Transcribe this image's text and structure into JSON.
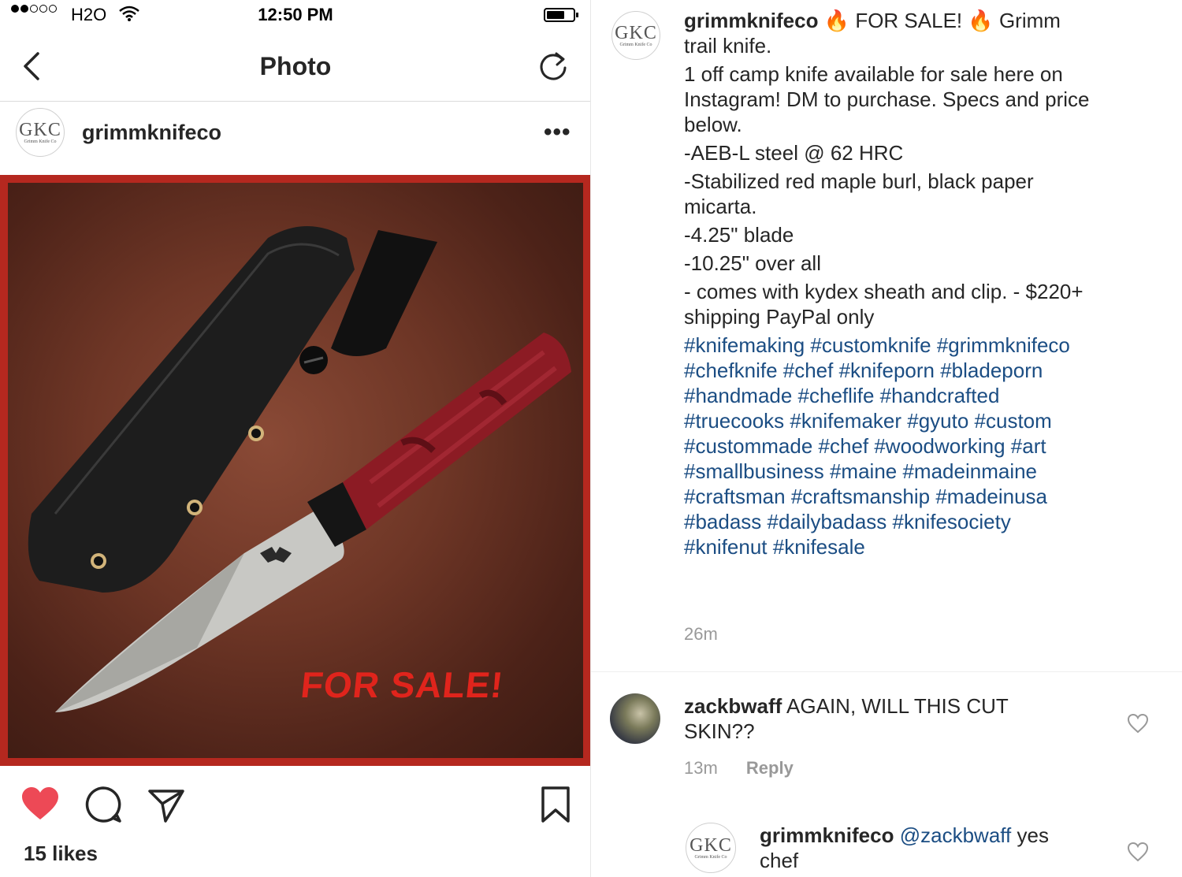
{
  "status_bar": {
    "carrier": "H2O",
    "time": "12:50 PM"
  },
  "nav": {
    "title": "Photo",
    "back_icon": "chevron-left-icon",
    "refresh_icon": "refresh-icon"
  },
  "post": {
    "username": "grimmknifeco",
    "avatar_monogram": "GKC",
    "avatar_subtext": "Grimm Knife Co",
    "more_label": "•••",
    "overlay_text": "FOR SALE!",
    "likes": "15 likes",
    "liked": true,
    "colors": {
      "like": "#ed4956",
      "photo_border": "#e3251b",
      "hashtag": "#1b4d83"
    }
  },
  "caption": {
    "username": "grimmknifeco",
    "first_line": " 🔥 FOR SALE! 🔥 Grimm trail knife.",
    "lines": [
      "1 off camp knife available for sale here on Instagram! DM to purchase. Specs and price below.",
      "-AEB-L steel @ 62 HRC",
      "-Stabilized red maple burl, black paper micarta.",
      "-4.25\" blade",
      "-10.25\" over all",
      "- comes with kydex sheath and clip. - $220+ shipping PayPal only"
    ],
    "hashtags": "#knifemaking #customknife #grimmknifeco #chefknife #chef #knifeporn #bladeporn #handmade #cheflife #handcrafted #truecooks #knifemaker #gyuto #custom #custommade #chef #woodworking #art #smallbusiness #maine #madeinmaine #craftsman #craftsmanship  #madeinusa #badass #dailybadass #knifesociety #knifenut #knifesale",
    "time": "26m"
  },
  "comments": [
    {
      "username": "zackbwaff",
      "text": " AGAIN, WILL THIS CUT SKIN??",
      "time": "13m",
      "reply_label": "Reply"
    },
    {
      "username": "grimmknifeco",
      "mention": "@zackbwaff",
      "text": " yes chef"
    }
  ]
}
